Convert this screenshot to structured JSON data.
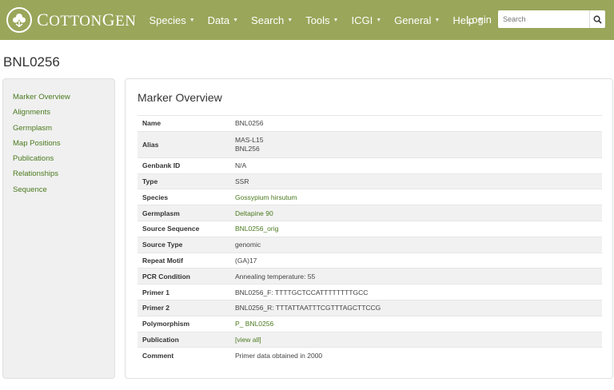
{
  "brand": {
    "first": "C",
    "rest": "OTTON",
    "first2": "G",
    "rest2": "EN"
  },
  "nav": [
    "Species",
    "Data",
    "Search",
    "Tools",
    "ICGI",
    "General",
    "Help"
  ],
  "login": "Login",
  "search": {
    "placeholder": "Search"
  },
  "page_title": "BNL0256",
  "sidebar": [
    "Marker Overview",
    "Alignments",
    "Germplasm",
    "Map Positions",
    "Publications",
    "Relationships",
    "Sequence"
  ],
  "panel_title": "Marker Overview",
  "fields": {
    "name": {
      "label": "Name",
      "value": "BNL0256"
    },
    "alias": {
      "label": "Alias",
      "value1": "MAS-L15",
      "value2": "BNL256"
    },
    "genbank": {
      "label": "Genbank ID",
      "value": "N/A"
    },
    "type": {
      "label": "Type",
      "value": "SSR"
    },
    "species": {
      "label": "Species",
      "value": "Gossypium hirsutum"
    },
    "germplasm": {
      "label": "Germplasm",
      "value": "Deltapine 90"
    },
    "source_sequence": {
      "label": "Source Sequence",
      "value": "BNL0256_orig"
    },
    "source_type": {
      "label": "Source Type",
      "value": "genomic"
    },
    "repeat_motif": {
      "label": "Repeat Motif",
      "value": "(GA)17"
    },
    "pcr": {
      "label": "PCR Condition",
      "value": "Annealing temperature: 55"
    },
    "primer1": {
      "label": "Primer 1",
      "value": "BNL0256_F: TTTTGCTCCATTTTTTTTGCC"
    },
    "primer2": {
      "label": "Primer 2",
      "value": "BNL0256_R: TTTATTAATTTCGTTTAGCTTCCG"
    },
    "polymorphism": {
      "label": "Polymorphism",
      "value": "P_ BNL0256"
    },
    "publication": {
      "label": "Publication",
      "value": "[view all]"
    },
    "comment": {
      "label": "Comment",
      "value": "Primer data obtained in 2000"
    }
  },
  "colors": {
    "navbar": "#9aa65a",
    "link": "#4a7a1e"
  }
}
